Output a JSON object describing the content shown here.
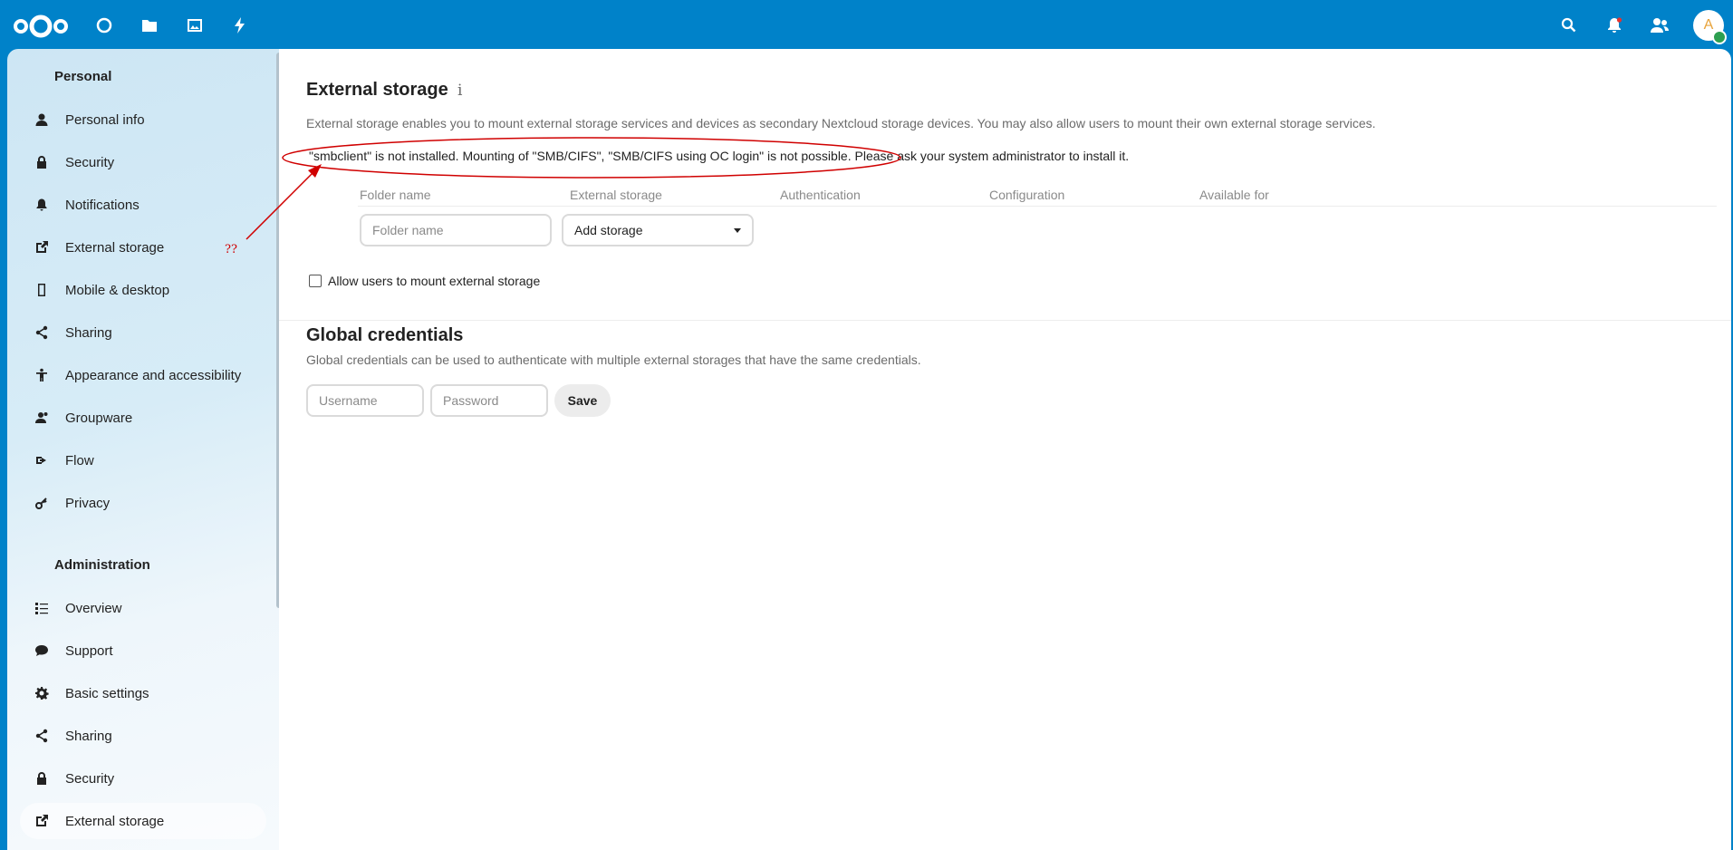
{
  "header": {
    "icons": [
      "nextcloud-logo",
      "dashboard-icon",
      "files-icon",
      "photos-icon",
      "activity-icon",
      "search-icon",
      "notifications-icon",
      "contacts-icon"
    ],
    "avatar_initial": "A",
    "colors": {
      "brand": "#0082c9",
      "status_online": "#2d9f50"
    }
  },
  "sidebar": {
    "personal_caption": "Personal",
    "personal_items": [
      {
        "label": "Personal info",
        "icon": "user-icon"
      },
      {
        "label": "Security",
        "icon": "lock-icon"
      },
      {
        "label": "Notifications",
        "icon": "bell-icon"
      },
      {
        "label": "External storage",
        "icon": "external-link-icon"
      },
      {
        "label": "Mobile & desktop",
        "icon": "phone-icon"
      },
      {
        "label": "Sharing",
        "icon": "share-icon"
      },
      {
        "label": "Appearance and accessibility",
        "icon": "accessibility-icon"
      },
      {
        "label": "Groupware",
        "icon": "groupware-icon"
      },
      {
        "label": "Flow",
        "icon": "flow-icon"
      },
      {
        "label": "Privacy",
        "icon": "key-icon"
      }
    ],
    "admin_caption": "Administration",
    "admin_items": [
      {
        "label": "Overview",
        "icon": "list-icon"
      },
      {
        "label": "Support",
        "icon": "chat-bubble-icon"
      },
      {
        "label": "Basic settings",
        "icon": "gear-icon"
      },
      {
        "label": "Sharing",
        "icon": "share-icon"
      },
      {
        "label": "Security",
        "icon": "lock-icon"
      },
      {
        "label": "External storage",
        "icon": "external-link-icon",
        "active": true
      }
    ]
  },
  "external_storage": {
    "title": "External storage",
    "info_glyph": "i",
    "description": "External storage enables you to mount external storage services and devices as secondary Nextcloud storage devices. You may also allow users to mount their own external storage services.",
    "warning": "\"smbclient\" is not installed. Mounting of \"SMB/CIFS\", \"SMB/CIFS using OC login\" is not possible. Please ask your system administrator to install it.",
    "columns": [
      "Folder name",
      "External storage",
      "Authentication",
      "Configuration",
      "Available for"
    ],
    "folder_name_placeholder": "Folder name",
    "add_storage_label": "Add storage",
    "allow_users_label": "Allow users to mount external storage",
    "allow_users_checked": false
  },
  "global_credentials": {
    "title": "Global credentials",
    "description": "Global credentials can be used to authenticate with multiple external storages that have the same credentials.",
    "username_placeholder": "Username",
    "password_placeholder": "Password",
    "save_label": "Save"
  },
  "annotation": {
    "question_marks": "??",
    "color": "#d00000"
  }
}
